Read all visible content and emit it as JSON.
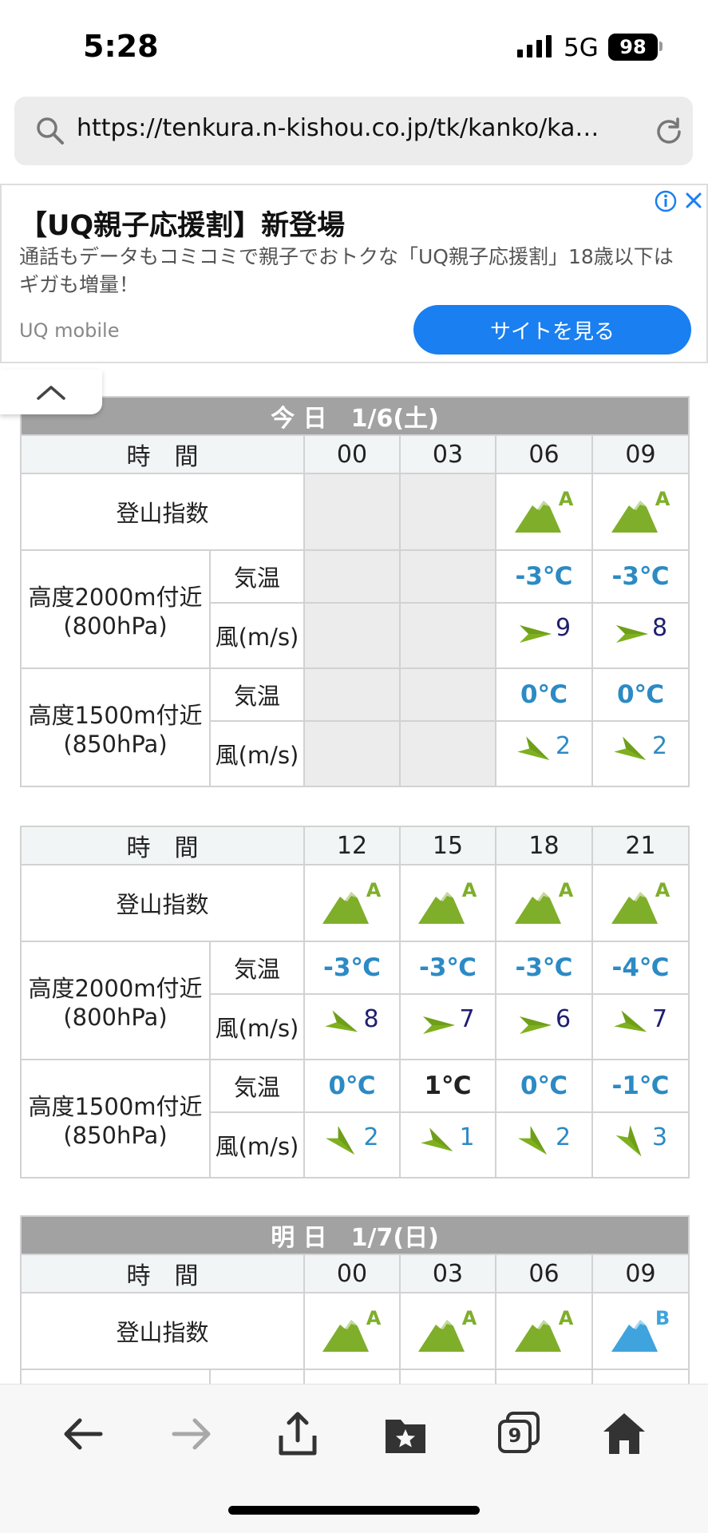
{
  "status_bar": {
    "time": "5:28",
    "network": "5G",
    "battery": "98"
  },
  "browser": {
    "url": "https://tenkura.n-kishou.co.jp/tk/kanko/ka…"
  },
  "ad": {
    "title": "【UQ親子応援割】新登場",
    "body": "通話もデータもコミコミで親子でおトクな「UQ親子応援割」18歳以下はギガも増量！",
    "brand": "UQ mobile",
    "cta": "サイトを見る"
  },
  "labels": {
    "time": "時　間",
    "index": "登山指数",
    "alt2000": "高度2000m付近",
    "hpa800": "(800hPa)",
    "alt1500": "高度1500m付近",
    "hpa850": "(850hPa)",
    "temp": "気温",
    "wind": "風(m/s)"
  },
  "tables": [
    {
      "day": "今 日　1/6(土)",
      "hours": [
        "00",
        "03",
        "06",
        "09"
      ],
      "index": [
        "",
        "",
        "A",
        "A"
      ],
      "t2000": [
        "",
        "",
        "-3℃",
        "-3℃"
      ],
      "w2000": [
        "",
        "",
        "9",
        "8"
      ],
      "t1500": [
        "",
        "",
        "0℃",
        "0℃"
      ],
      "w1500": [
        "",
        "",
        "2",
        "2"
      ]
    },
    {
      "day": "",
      "hours": [
        "12",
        "15",
        "18",
        "21"
      ],
      "index": [
        "A",
        "A",
        "A",
        "A"
      ],
      "t2000": [
        "-3℃",
        "-3℃",
        "-3℃",
        "-4℃"
      ],
      "w2000": [
        "8",
        "7",
        "6",
        "7"
      ],
      "t1500": [
        "0℃",
        "1℃",
        "0℃",
        "-1℃"
      ],
      "w1500": [
        "2",
        "1",
        "2",
        "3"
      ]
    },
    {
      "day": "明 日　1/7(日)",
      "hours": [
        "00",
        "03",
        "06",
        "09"
      ],
      "index": [
        "A",
        "A",
        "A",
        "B"
      ]
    }
  ],
  "colors": {
    "index_A": "#7fae2a",
    "index_B": "#3fa3dd",
    "temp_blue": "#2c8ac4",
    "wind_arrow": "#7fb01f",
    "cta_blue": "#1a7ff0"
  },
  "toolbar": {
    "tabs_count": "9",
    "icons": [
      "back-icon",
      "forward-icon",
      "share-icon",
      "bookmarks-icon",
      "tabs-icon",
      "home-icon"
    ]
  }
}
